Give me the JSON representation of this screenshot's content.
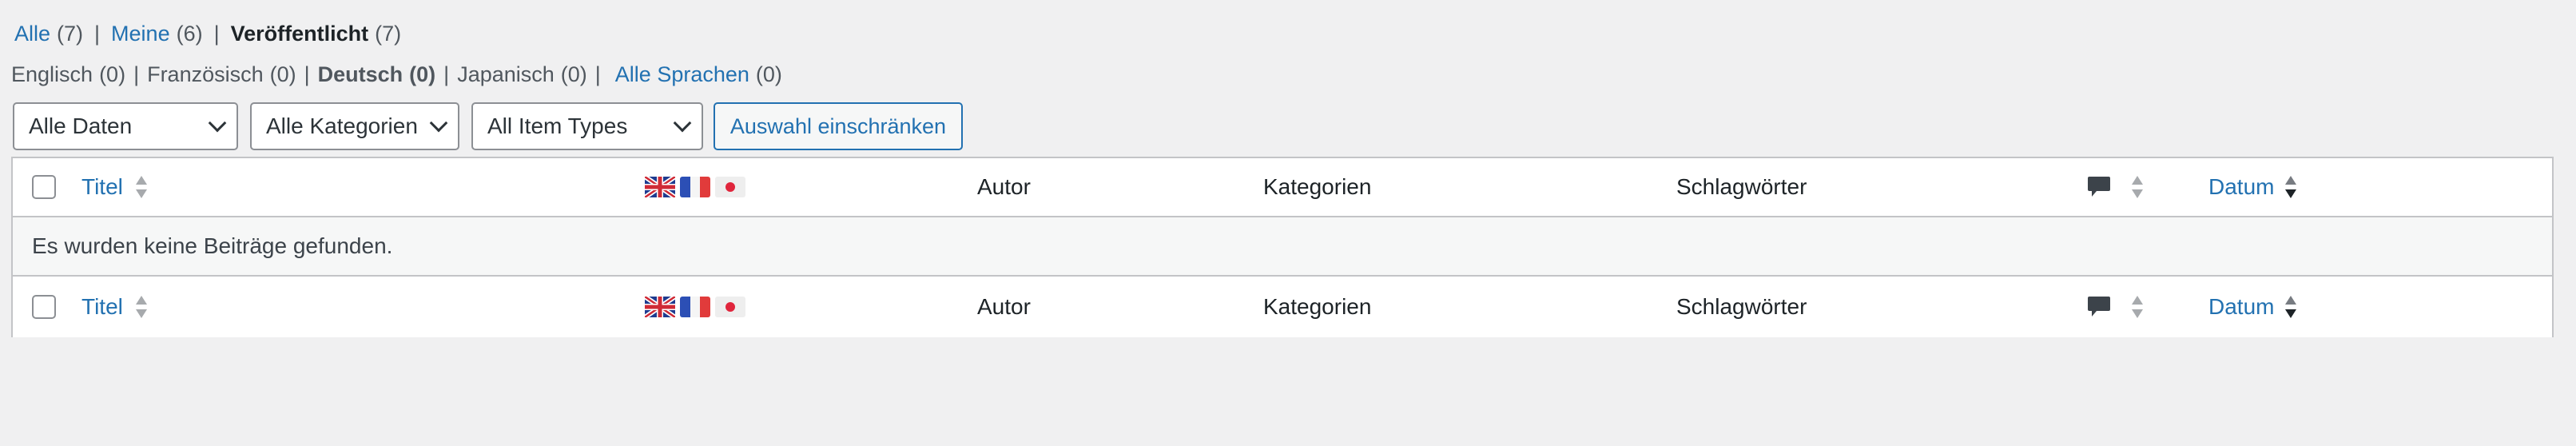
{
  "status_filters": [
    {
      "label": "Alle",
      "count": "(7)"
    },
    {
      "label": "Meine",
      "count": "(6)"
    },
    {
      "label": "Veröffentlicht",
      "count": "(7)"
    }
  ],
  "status_separator": "|",
  "languages": [
    {
      "label": "Englisch",
      "count": "(0)"
    },
    {
      "label": "Französisch",
      "count": "(0)"
    },
    {
      "label": "Deutsch",
      "count": "(0)"
    },
    {
      "label": "Japanisch",
      "count": "(0)"
    },
    {
      "label": "Alle Sprachen",
      "count": "(0)"
    }
  ],
  "filters": {
    "dates": "Alle Daten",
    "categories": "Alle Kategorien",
    "item_types": "All Item Types",
    "submit_label": "Auswahl einschränken"
  },
  "columns": {
    "title": "Titel",
    "author": "Autor",
    "categories": "Kategorien",
    "tags": "Schlagwörter",
    "date": "Datum"
  },
  "language_flags": [
    "uk-flag-icon",
    "france-flag-icon",
    "japan-flag-icon"
  ],
  "empty_message": "Es wurden keine Beiträge gefunden.",
  "colors": {
    "link": "#2271b1",
    "background": "#f0f0f1",
    "border": "#c3c4c7"
  }
}
